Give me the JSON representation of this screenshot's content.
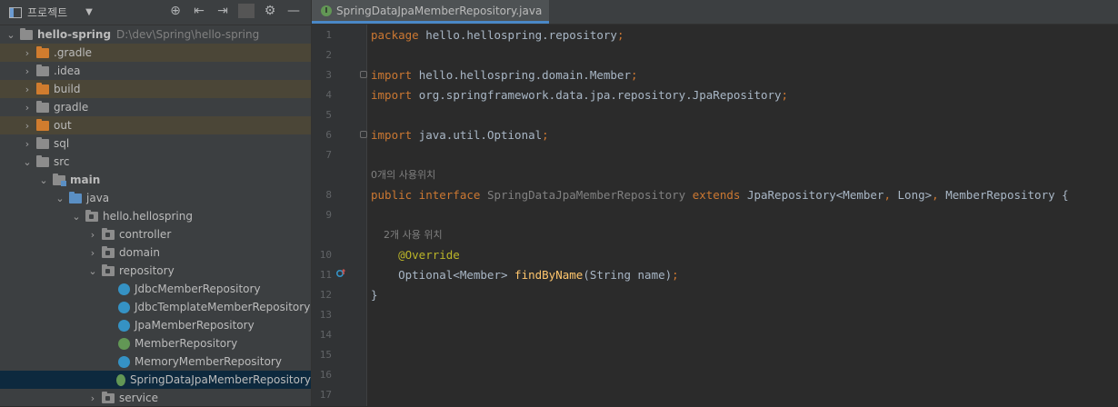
{
  "project_panel": {
    "title": "프로젝트",
    "caret": "▼",
    "tools": [
      "⊕",
      "⇤",
      "⇥",
      "⚙",
      "—"
    ],
    "tree": [
      {
        "depth": 0,
        "arrow": "⌄",
        "icon": "folder-grey",
        "label": "hello-spring",
        "bold": true,
        "path": "D:\\dev\\Spring\\hello-spring"
      },
      {
        "depth": 1,
        "arrow": "›",
        "icon": "folder-orange",
        "label": ".gradle",
        "excluded": true
      },
      {
        "depth": 1,
        "arrow": "›",
        "icon": "folder-grey",
        "label": ".idea"
      },
      {
        "depth": 1,
        "arrow": "›",
        "icon": "folder-orange",
        "label": "build",
        "excluded": true
      },
      {
        "depth": 1,
        "arrow": "›",
        "icon": "folder-grey",
        "label": "gradle"
      },
      {
        "depth": 1,
        "arrow": "›",
        "icon": "folder-orange",
        "label": "out",
        "excluded": true
      },
      {
        "depth": 1,
        "arrow": "›",
        "icon": "folder-grey",
        "label": "sql"
      },
      {
        "depth": 1,
        "arrow": "⌄",
        "icon": "folder-grey",
        "label": "src"
      },
      {
        "depth": 2,
        "arrow": "⌄",
        "icon": "folder-main",
        "label": "main",
        "bold": true
      },
      {
        "depth": 3,
        "arrow": "⌄",
        "icon": "folder-blue",
        "label": "java"
      },
      {
        "depth": 4,
        "arrow": "⌄",
        "icon": "folder-pkg",
        "label": "hello.hellospring"
      },
      {
        "depth": 5,
        "arrow": "›",
        "icon": "folder-pkg",
        "label": "controller"
      },
      {
        "depth": 5,
        "arrow": "›",
        "icon": "folder-pkg",
        "label": "domain"
      },
      {
        "depth": 5,
        "arrow": "⌄",
        "icon": "folder-pkg",
        "label": "repository"
      },
      {
        "depth": 6,
        "arrow": "",
        "icon": "class",
        "label": "JdbcMemberRepository"
      },
      {
        "depth": 6,
        "arrow": "",
        "icon": "class",
        "label": "JdbcTemplateMemberRepository"
      },
      {
        "depth": 6,
        "arrow": "",
        "icon": "class",
        "label": "JpaMemberRepository"
      },
      {
        "depth": 6,
        "arrow": "",
        "icon": "interface",
        "label": "MemberRepository"
      },
      {
        "depth": 6,
        "arrow": "",
        "icon": "class",
        "label": "MemoryMemberRepository"
      },
      {
        "depth": 6,
        "arrow": "",
        "icon": "interface",
        "label": "SpringDataJpaMemberRepository",
        "selected": true
      },
      {
        "depth": 5,
        "arrow": "›",
        "icon": "folder-pkg",
        "label": "service"
      }
    ]
  },
  "editor": {
    "tab_label": "SpringDataJpaMemberRepository.java",
    "tab_icon_letter": "I",
    "lines": [
      {
        "n": "1",
        "fold": false,
        "segs": [
          [
            "kw",
            "package "
          ],
          [
            "tx",
            "hello.hellospring.repository"
          ],
          [
            "kw",
            ";"
          ]
        ]
      },
      {
        "n": "2",
        "segs": []
      },
      {
        "n": "3",
        "fold": true,
        "segs": [
          [
            "kw",
            "import "
          ],
          [
            "tx",
            "hello.hellospring.domain.Member"
          ],
          [
            "kw",
            ";"
          ]
        ]
      },
      {
        "n": "4",
        "segs": [
          [
            "kw",
            "import "
          ],
          [
            "tx",
            "org.springframework.data.jpa.repository.JpaRepository"
          ],
          [
            "kw",
            ";"
          ]
        ]
      },
      {
        "n": "5",
        "segs": []
      },
      {
        "n": "6",
        "fold": true,
        "segs": [
          [
            "kw",
            "import "
          ],
          [
            "tx",
            "java.util.Optional"
          ],
          [
            "kw",
            ";"
          ]
        ]
      },
      {
        "n": "7",
        "segs": []
      },
      {
        "n": "",
        "hint": true,
        "segs": [
          [
            "hint",
            "0개의 사용위치"
          ]
        ]
      },
      {
        "n": "8",
        "segs": [
          [
            "kw",
            "public interface "
          ],
          [
            "gr",
            "SpringDataJpaMemberRepository "
          ],
          [
            "kw",
            "extends "
          ],
          [
            "tx",
            "JpaRepository<Member"
          ],
          [
            "kw",
            ", "
          ],
          [
            "tx",
            "Long>"
          ],
          [
            "kw",
            ", "
          ],
          [
            "tx",
            "MemberRepository {"
          ]
        ]
      },
      {
        "n": "9",
        "segs": []
      },
      {
        "n": "",
        "hint": true,
        "segs": [
          [
            "hint",
            "    2개 사용 위치"
          ]
        ]
      },
      {
        "n": "10",
        "segs": [
          [
            "ann",
            "    @Override"
          ]
        ]
      },
      {
        "n": "11",
        "mark": "override",
        "segs": [
          [
            "tx",
            "    Optional<Member> "
          ],
          [
            "fn",
            "findByName"
          ],
          [
            "tx",
            "(String name)"
          ],
          [
            "kw",
            ";"
          ]
        ]
      },
      {
        "n": "12",
        "segs": [
          [
            "tx",
            "}"
          ]
        ]
      },
      {
        "n": "13",
        "segs": []
      },
      {
        "n": "14",
        "segs": []
      },
      {
        "n": "15",
        "segs": []
      },
      {
        "n": "16",
        "segs": []
      },
      {
        "n": "17",
        "segs": []
      }
    ]
  }
}
